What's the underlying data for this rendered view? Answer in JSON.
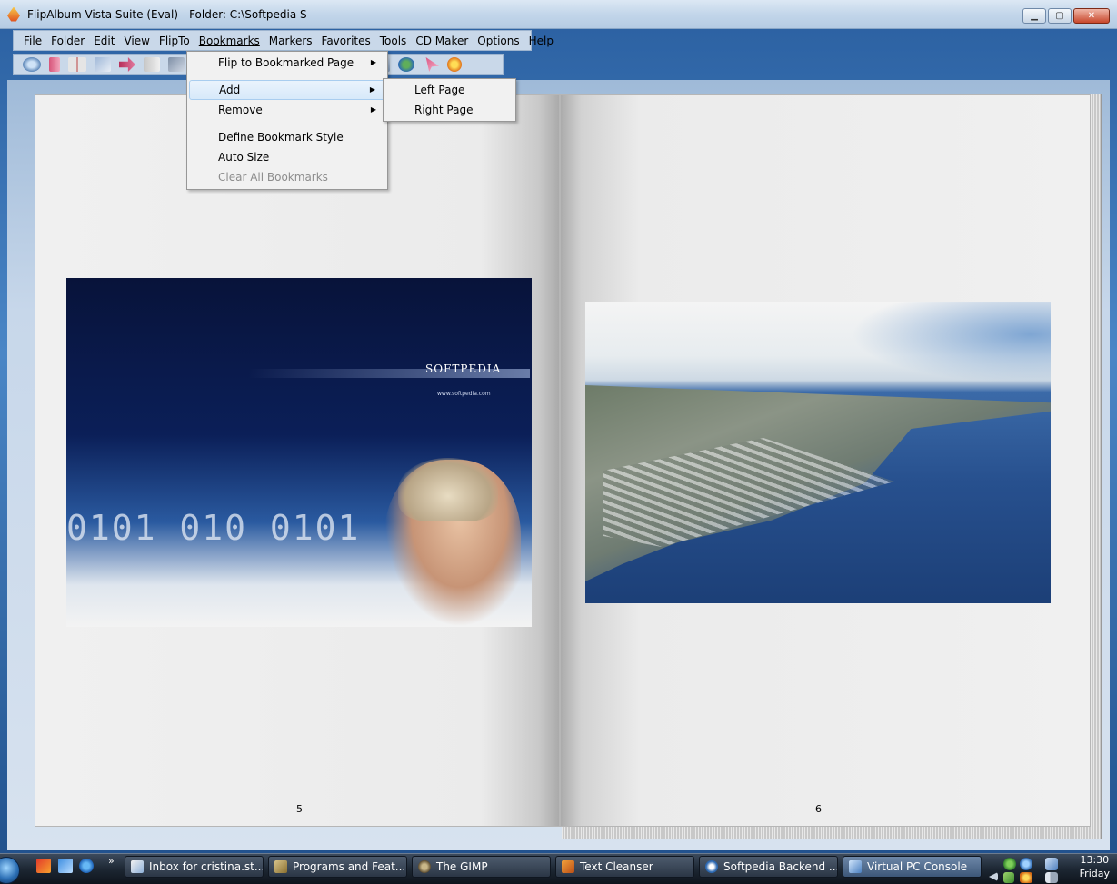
{
  "window": {
    "app_title": "FlipAlbum Vista Suite (Eval)",
    "folder_label": "Folder: C:\\Softpedia S",
    "minimize": "▁",
    "maximize": "▢",
    "close": "✕"
  },
  "menu": [
    "File",
    "Folder",
    "Edit",
    "View",
    "FlipTo",
    "Bookmarks",
    "Markers",
    "Favorites",
    "Tools",
    "CD Maker",
    "Options",
    "Help"
  ],
  "bookmarks_menu": {
    "items": [
      {
        "label": "Flip to Bookmarked Page",
        "arrow": "▶"
      },
      {
        "label": "Add",
        "arrow": "▶"
      },
      {
        "label": "Remove",
        "arrow": "▶"
      },
      {
        "label": "Define Bookmark Style"
      },
      {
        "label": "Auto Size"
      },
      {
        "label": "Clear All Bookmarks"
      }
    ],
    "submenu": [
      "Left Page",
      "Right Page"
    ]
  },
  "book": {
    "left_page_number": "5",
    "right_page_number": "6",
    "left_photo_brand": "SOFTPEDIA",
    "left_photo_url": "www.softpedia.com",
    "left_photo_digits": "0101 010 0101"
  },
  "taskbar": {
    "quicklaunch_more": "»",
    "tasks": [
      "Inbox for cristina.st...",
      "Programs and Feat...",
      "The GIMP",
      "Text Cleanser",
      "Softpedia Backend ...",
      "Virtual PC Console"
    ],
    "time": "13:30",
    "day": "Friday"
  },
  "colors": {
    "menu_highlight": "#d7e9fa",
    "taskbar": "#1d2733"
  }
}
